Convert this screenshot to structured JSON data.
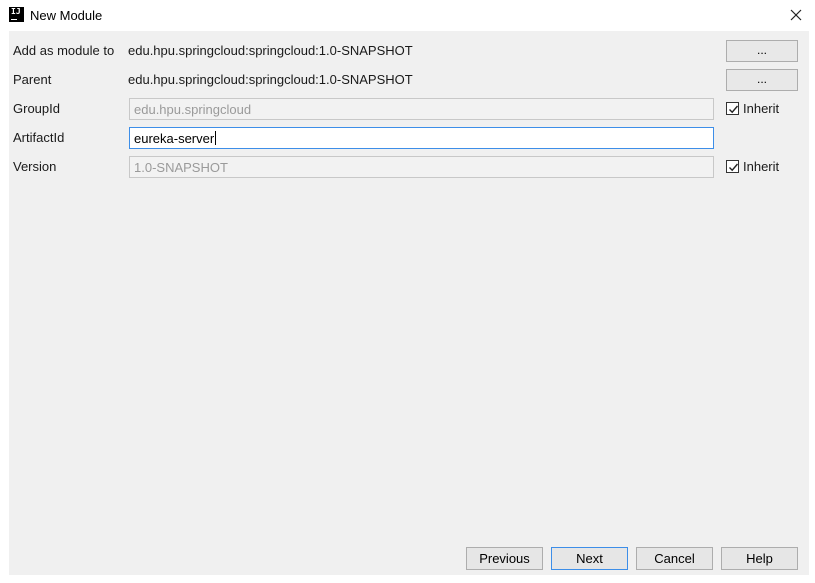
{
  "window": {
    "title": "New Module",
    "icon": "intellij-idea-icon",
    "icon_text": "IJ"
  },
  "form": {
    "add_as_module_to": {
      "label": "Add as module to",
      "value": "edu.hpu.springcloud:springcloud:1.0-SNAPSHOT",
      "button": "..."
    },
    "parent": {
      "label": "Parent",
      "value": "edu.hpu.springcloud:springcloud:1.0-SNAPSHOT",
      "button": "..."
    },
    "group_id": {
      "label": "GroupId",
      "value": "edu.hpu.springcloud",
      "inherit_label": "Inherit",
      "inherit_checked": true
    },
    "artifact_id": {
      "label": "ArtifactId",
      "value": "eureka-server"
    },
    "version": {
      "label": "Version",
      "value": "1.0-SNAPSHOT",
      "inherit_label": "Inherit",
      "inherit_checked": true
    }
  },
  "buttons": {
    "previous": "Previous",
    "next": "Next",
    "cancel": "Cancel",
    "help": "Help"
  },
  "colors": {
    "content_bg": "#f0f0f0",
    "focus_border": "#3d8ee8"
  }
}
